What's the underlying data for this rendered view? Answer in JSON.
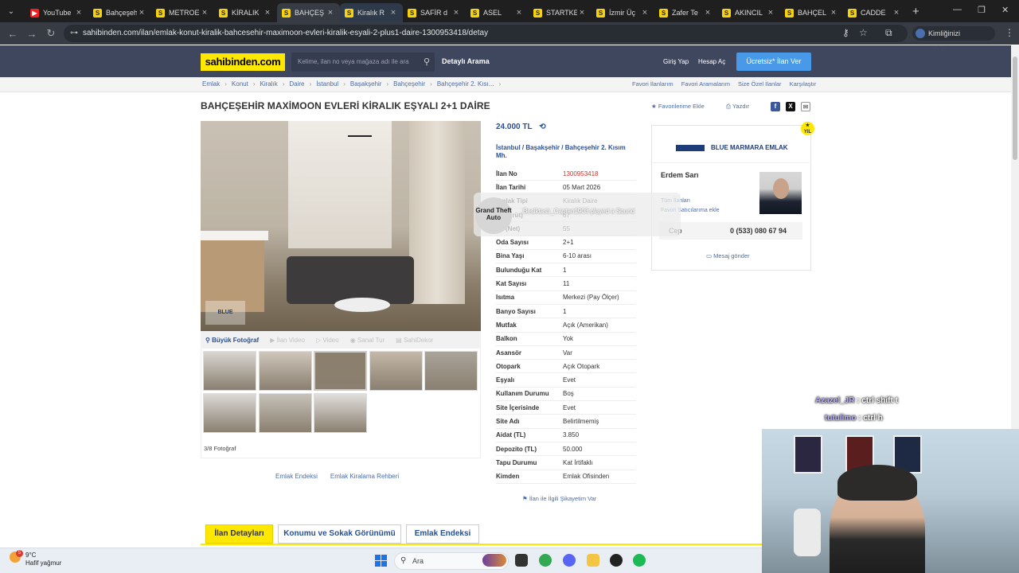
{
  "browser": {
    "tabs": [
      {
        "title": "YouTube",
        "favicon": "youtube"
      },
      {
        "title": "Bahçeşeh",
        "favicon": "s"
      },
      {
        "title": "METROE",
        "favicon": "s"
      },
      {
        "title": "KİRALIK",
        "favicon": "s"
      },
      {
        "title": "BAHÇEŞ",
        "favicon": "s"
      },
      {
        "title": "Kiralık R",
        "favicon": "s"
      },
      {
        "title": "SAFİR d",
        "favicon": "s"
      },
      {
        "title": "ASEL",
        "favicon": "s"
      },
      {
        "title": "STARTKE",
        "favicon": "s"
      },
      {
        "title": "İzmir Üç",
        "favicon": "s"
      },
      {
        "title": "Zafer Te",
        "favicon": "s"
      },
      {
        "title": "AKINCIL",
        "favicon": "s"
      },
      {
        "title": "BAHÇEL",
        "favicon": "s"
      },
      {
        "title": "CADDE",
        "favicon": "s"
      }
    ],
    "url": "sahibinden.com/ilan/emlak-konut-kiralik-bahcesehir-maximoon-evleri-kiralik-esyali-2-plus1-daire-1300953418/detay",
    "profile_label": "Kimliğinizi doğrulayın"
  },
  "site": {
    "logo": "sahibinden.com",
    "search_placeholder": "Kelime, ilan no veya mağaza adı ile ara",
    "detailed_search": "Detaylı Arama",
    "login": "Giriş Yap",
    "register": "Hesap Aç",
    "post_ad": "Ücretsiz* İlan Ver"
  },
  "breadcrumb": [
    "Emlak",
    "Konut",
    "Kiralık",
    "Daire",
    "İstanbul",
    "Başakşehir",
    "Bahçeşehir",
    "Bahçeşehir 2. Kısı..."
  ],
  "breadcrumb_right": [
    "Favori İlanlarım",
    "Favori Aramalarım",
    "Size Özel İlanlar",
    "Karşılaştır"
  ],
  "listing": {
    "title": "BAHÇEŞEHİR MAXİMOON EVLERİ KİRALIK EŞYALI 2+1 DAİRE",
    "add_favorite": "Favorilerime Ekle",
    "print": "Yazdır",
    "price": "24.000 TL",
    "location": [
      "İstanbul",
      "Başakşehir",
      "Bahçeşehir 2. Kısım Mh."
    ],
    "photo_tools": [
      "Büyük Fotoğraf",
      "İlan Video",
      "Video",
      "Sanal Tur",
      "SahiDekor"
    ],
    "photo_count": "3/8 Fotoğraf",
    "watermark": "BLUE",
    "links": [
      "Emlak Endeksi",
      "Emlak Kiralama Rehberi"
    ],
    "complaint": "İlan ile İlgili Şikayetim Var",
    "specs": [
      {
        "k": "İlan No",
        "v": "1300953418"
      },
      {
        "k": "İlan Tarihi",
        "v": "05 Mart 2026"
      },
      {
        "k": "Emlak Tipi",
        "v": "Kiralık Daire"
      },
      {
        "k": "m² (Brüt)",
        "v": "67"
      },
      {
        "k": "m² (Net)",
        "v": "55"
      },
      {
        "k": "Oda Sayısı",
        "v": "2+1"
      },
      {
        "k": "Bina Yaşı",
        "v": "6-10 arası"
      },
      {
        "k": "Bulunduğu Kat",
        "v": "1"
      },
      {
        "k": "Kat Sayısı",
        "v": "11"
      },
      {
        "k": "Isıtma",
        "v": "Merkezi (Pay Ölçer)"
      },
      {
        "k": "Banyo Sayısı",
        "v": "1"
      },
      {
        "k": "Mutfak",
        "v": "Açık (Amerikan)"
      },
      {
        "k": "Balkon",
        "v": "Yok"
      },
      {
        "k": "Asansör",
        "v": "Var"
      },
      {
        "k": "Otopark",
        "v": "Açık Otopark"
      },
      {
        "k": "Eşyalı",
        "v": "Evet"
      },
      {
        "k": "Kullanım Durumu",
        "v": "Boş"
      },
      {
        "k": "Site İçerisinde",
        "v": "Evet"
      },
      {
        "k": "Site Adı",
        "v": "Belirtilmemiş"
      },
      {
        "k": "Aidat (TL)",
        "v": "3.850"
      },
      {
        "k": "Depozito (TL)",
        "v": "50.000"
      },
      {
        "k": "Tapu Durumu",
        "v": "Kat İrtifaklı"
      },
      {
        "k": "Kimden",
        "v": "Emlak Ofisinden"
      }
    ]
  },
  "seller": {
    "office": "BLUE MARMARA EMLAK",
    "agent": "Erdem Sarı",
    "all_listings": "Tüm İlanları",
    "add_fav_seller": "Favori Satıcılarıma ekle",
    "phone_label": "Cep",
    "phone": "0 (533) 080 67 94",
    "message": "Mesaj gönder"
  },
  "detail_tabs": [
    "İlan Detayları",
    "Konumu ve Sokak Görünümü",
    "Emlak Endeksi"
  ],
  "overlay": {
    "toast": "Besiktaslı_Captan1903 played a Sound",
    "game_logo": "Grand Theft Auto",
    "chat": [
      {
        "user": "Azazel_JR",
        "msg": "ctrl shift t"
      },
      {
        "user": "tutulimo",
        "msg": "ctrl h"
      }
    ]
  },
  "taskbar": {
    "temp": "9°C",
    "weather": "Hafif yağmur",
    "weather_badge": "5",
    "search": "Ara"
  }
}
